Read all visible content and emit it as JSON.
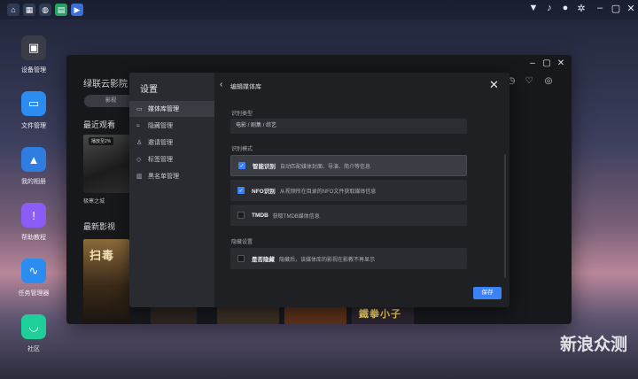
{
  "colors": {
    "accent": "#3b82f6",
    "dialog_bg": "#1f2024",
    "sidebar_bg": "#2a2b30"
  },
  "topbar": {
    "left_icons": [
      "home-icon",
      "grid-icon",
      "globe-icon",
      "file-icon",
      "media-icon"
    ],
    "right_icons": [
      "pin-icon",
      "bell-icon",
      "user-icon",
      "gear-icon",
      "minimize-icon",
      "maximize-icon",
      "close-icon"
    ]
  },
  "desktop": {
    "apps": [
      {
        "label": "设备管理",
        "icon": "device-icon"
      },
      {
        "label": "文件管理",
        "icon": "folder-icon"
      },
      {
        "label": "我的相册",
        "icon": "photo-icon"
      },
      {
        "label": "帮助教程",
        "icon": "help-icon"
      },
      {
        "label": "任务管理器",
        "icon": "chart-icon"
      },
      {
        "label": "社区",
        "icon": "chat-icon"
      }
    ]
  },
  "app": {
    "title": "绿联云影院",
    "tab_label": "影视",
    "recent_heading": "最近观看",
    "recent_item": {
      "badge": "播放至2%",
      "caption": "极寒之城"
    },
    "latest_heading": "最新影视",
    "latest_poster_title": "扫毒",
    "strip_text": "鐵拳小子"
  },
  "dialog": {
    "title": "设置",
    "sidebar": [
      {
        "label": "媒体库管理",
        "icon": "library-icon",
        "active": true
      },
      {
        "label": "隐藏管理",
        "icon": "eye-off-icon",
        "active": false
      },
      {
        "label": "邀请管理",
        "icon": "invite-icon",
        "active": false
      },
      {
        "label": "标签管理",
        "icon": "tag-icon",
        "active": false
      },
      {
        "label": "黑名单管理",
        "icon": "blacklist-icon",
        "active": false
      }
    ],
    "header": "编辑媒体库",
    "type_section": "识别类型",
    "type_value": "电影 / 剧集 / 综艺",
    "mode_section": "识别模式",
    "modes": [
      {
        "title": "智能识别",
        "desc": "自动匹配媒体封面、导演、简介等信息",
        "checked": true
      },
      {
        "title": "NFO识别",
        "desc": "从视频所在目录的NFO文件获取媒体信息",
        "checked": true
      },
      {
        "title": "TMDB",
        "desc": "获取TMDB媒体信息",
        "checked": false
      }
    ],
    "hide_section": "隐藏设置",
    "hide_option": {
      "title": "是否隐藏",
      "desc": "隐藏后，该媒体库的影视在影教不再显示",
      "checked": false
    },
    "save_label": "保存",
    "check_mark": "✓"
  },
  "watermark": "新浪众测"
}
